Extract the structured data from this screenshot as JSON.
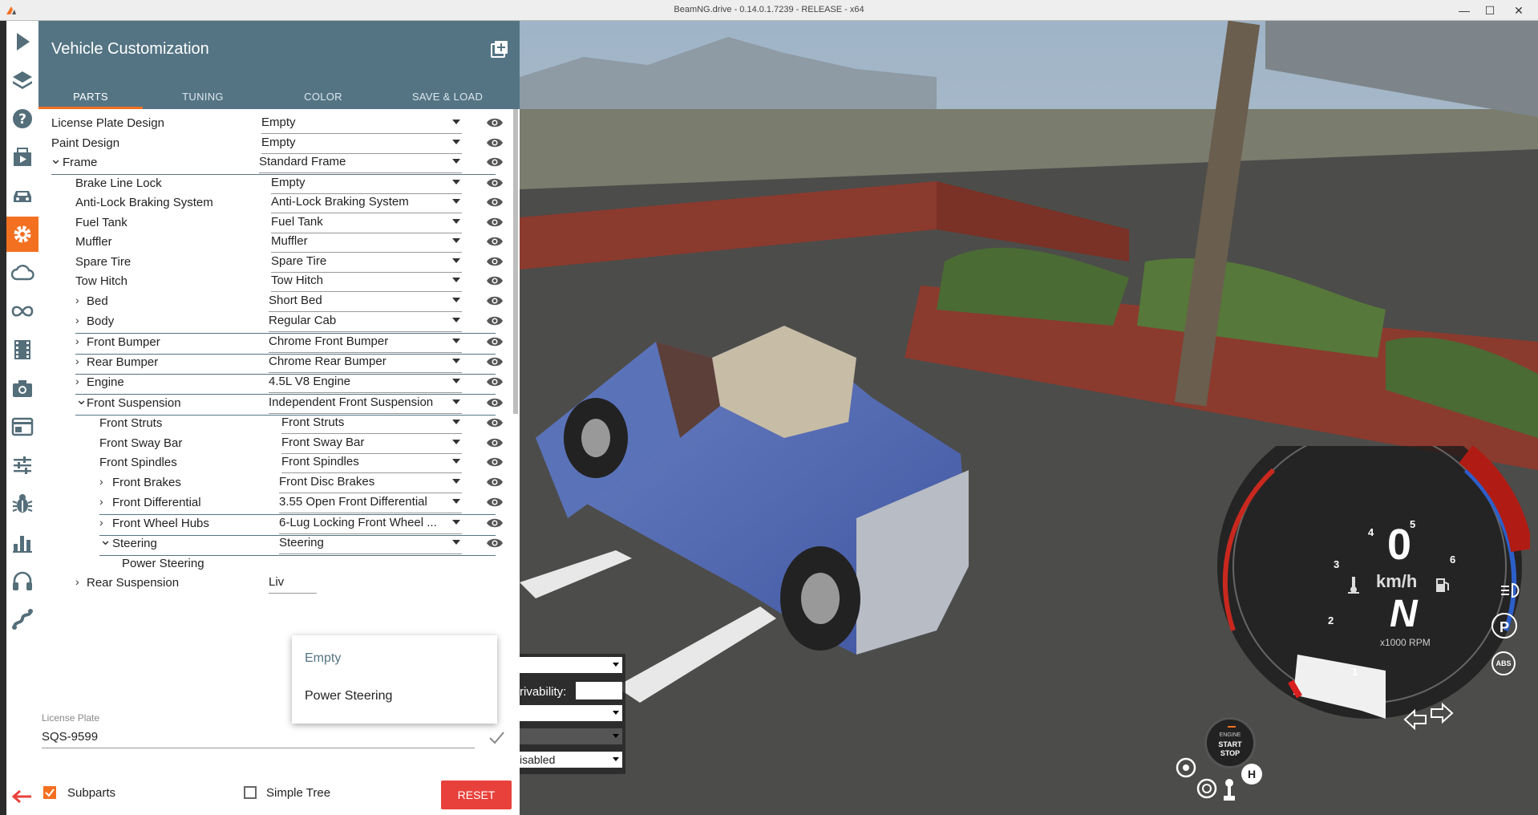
{
  "window": {
    "title": "BeamNG.drive - 0.14.0.1.7239 - RELEASE - x64",
    "minimize": "—",
    "maximize": "☐",
    "close": "✕"
  },
  "panel": {
    "title": "Vehicle Customization",
    "tabs": [
      "PARTS",
      "TUNING",
      "COLOR",
      "SAVE & LOAD"
    ],
    "active_tab": "PARTS"
  },
  "parts": [
    {
      "label": "License Plate Design",
      "value": "Empty"
    },
    {
      "label": "Paint Design",
      "value": "Empty"
    },
    {
      "label": "Frame",
      "value": "Standard Frame",
      "expander": "open"
    },
    {
      "label": "Brake Line Lock",
      "value": "Empty"
    },
    {
      "label": "Anti-Lock Braking System",
      "value": "Anti-Lock Braking System"
    },
    {
      "label": "Fuel Tank",
      "value": "Fuel Tank"
    },
    {
      "label": "Muffler",
      "value": "Muffler"
    },
    {
      "label": "Spare Tire",
      "value": "Spare Tire"
    },
    {
      "label": "Tow Hitch",
      "value": "Tow Hitch"
    },
    {
      "label": "Bed",
      "value": "Short Bed",
      "expander": "closed"
    },
    {
      "label": "Body",
      "value": "Regular Cab",
      "expander": "closed"
    },
    {
      "label": "Front Bumper",
      "value": "Chrome Front Bumper",
      "expander": "closed"
    },
    {
      "label": "Rear Bumper",
      "value": "Chrome Rear Bumper",
      "expander": "closed"
    },
    {
      "label": "Engine",
      "value": "4.5L V8 Engine",
      "expander": "closed"
    },
    {
      "label": "Front Suspension",
      "value": "Independent Front Suspension",
      "expander": "open"
    },
    {
      "label": "Front Struts",
      "value": "Front Struts"
    },
    {
      "label": "Front Sway Bar",
      "value": "Front Sway Bar"
    },
    {
      "label": "Front Spindles",
      "value": "Front Spindles"
    },
    {
      "label": "Front Brakes",
      "value": "Front Disc Brakes",
      "expander": "closed"
    },
    {
      "label": "Front Differential",
      "value": "3.55 Open Front Differential",
      "expander": "closed"
    },
    {
      "label": "Front Wheel Hubs",
      "value": "6-Lug Locking Front Wheel ...",
      "expander": "closed"
    },
    {
      "label": "Steering",
      "value": "Steering",
      "expander": "open"
    },
    {
      "label": "Power Steering",
      "value": ""
    },
    {
      "label": "Rear Suspension",
      "value": "Liv",
      "expander": "closed"
    }
  ],
  "dropdown": {
    "options": [
      "Empty",
      "Power Steering"
    ],
    "selected": "Empty"
  },
  "license_plate": {
    "label": "License Plate",
    "value": "SQS-9599"
  },
  "footer": {
    "subparts_label": "Subparts",
    "subparts_checked": true,
    "simple_tree_label": "Simple Tree",
    "simple_tree_checked": false,
    "reset_label": "RESET"
  },
  "sidebar_icons": [
    "play-icon",
    "layers-icon",
    "help-icon",
    "scenario-icon",
    "car-icon",
    "gear-icon",
    "cloud-icon",
    "infinity-icon",
    "film-icon",
    "camera-icon",
    "layout-icon",
    "sliders-icon",
    "bug-icon",
    "chart-icon",
    "headphones-icon",
    "road-icon"
  ],
  "overlay_menu": {
    "label": "rivability:",
    "field_last": "isabled"
  },
  "dashboard": {
    "speed": "0",
    "speed_unit": "km/h",
    "gear": "N",
    "rpm_label": "x1000 RPM",
    "rpm_ticks": [
      "1",
      "2",
      "3",
      "4",
      "5",
      "6"
    ],
    "engine_button": [
      "ENGINE",
      "START",
      "STOP"
    ],
    "abs_label": "ABS",
    "parking_label": "P",
    "hill_label": "H"
  },
  "colors": {
    "header": "#547484",
    "accent": "#f37021",
    "reset": "#e8413c"
  }
}
